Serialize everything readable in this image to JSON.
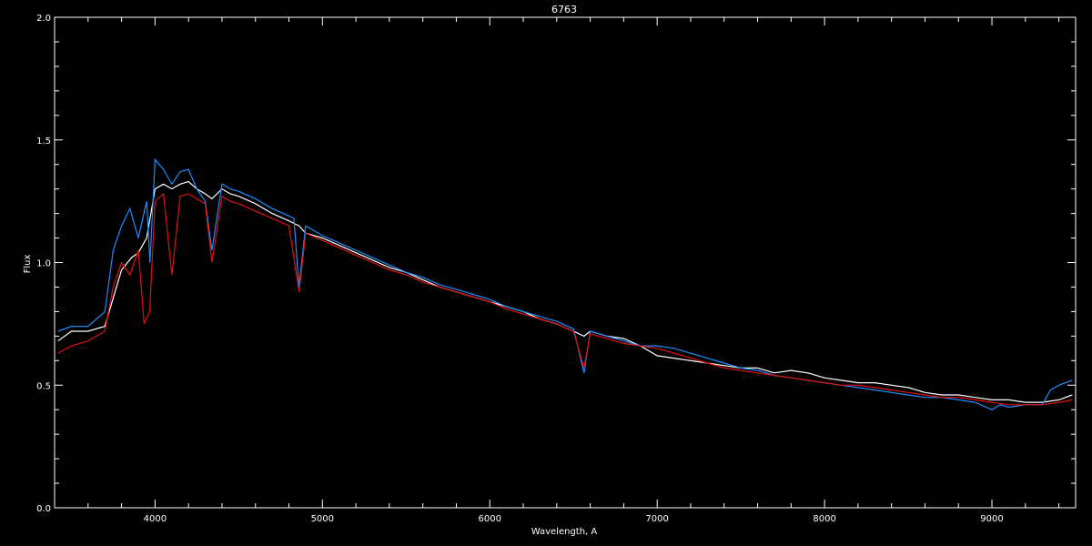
{
  "chart_data": {
    "type": "line",
    "title": "6763",
    "xlabel": "Wavelength, A",
    "ylabel": "Flux",
    "xlim": [
      3400,
      9500
    ],
    "ylim": [
      0,
      2
    ],
    "x_ticks": [
      4000,
      5000,
      6000,
      7000,
      8000,
      9000
    ],
    "x_tick_labels": [
      "4000",
      "5000",
      "6000",
      "7000",
      "8000",
      "9000"
    ],
    "y_ticks": [
      0,
      0.5,
      1,
      1.5,
      2
    ],
    "y_tick_labels": [
      "0.0",
      "0.5",
      "1.0",
      "1.5",
      "2.0"
    ],
    "grid": false,
    "background": "#000000",
    "colors": {
      "axes": "#ffffff",
      "observed_white": "#ffffff",
      "observed_blue": "#1e8cff",
      "model": "#e01010"
    },
    "series": [
      {
        "color": "#ffffff",
        "x": [
          3420,
          3500,
          3600,
          3700,
          3800,
          3860,
          3900,
          3950,
          4000,
          4050,
          4100,
          4150,
          4200,
          4250,
          4300,
          4340,
          4400,
          4450,
          4500,
          4600,
          4700,
          4800,
          4860,
          4900,
          5000,
          5100,
          5200,
          5300,
          5400,
          5500,
          5600,
          5700,
          5800,
          5900,
          6000,
          6100,
          6200,
          6300,
          6400,
          6500,
          6563,
          6600,
          6700,
          6800,
          6900,
          7000,
          7100,
          7200,
          7300,
          7400,
          7500,
          7600,
          7700,
          7800,
          7900,
          8000,
          8100,
          8200,
          8300,
          8400,
          8500,
          8600,
          8700,
          8800,
          8900,
          9000,
          9100,
          9200,
          9300,
          9400,
          9480
        ],
        "y": [
          0.68,
          0.72,
          0.72,
          0.74,
          0.97,
          1.02,
          1.04,
          1.1,
          1.3,
          1.32,
          1.3,
          1.32,
          1.33,
          1.3,
          1.28,
          1.26,
          1.3,
          1.28,
          1.27,
          1.24,
          1.2,
          1.17,
          1.15,
          1.12,
          1.1,
          1.07,
          1.04,
          1.01,
          0.98,
          0.96,
          0.93,
          0.9,
          0.88,
          0.86,
          0.84,
          0.82,
          0.8,
          0.77,
          0.75,
          0.72,
          0.7,
          0.72,
          0.7,
          0.69,
          0.66,
          0.62,
          0.61,
          0.6,
          0.59,
          0.58,
          0.57,
          0.57,
          0.55,
          0.56,
          0.55,
          0.53,
          0.52,
          0.51,
          0.51,
          0.5,
          0.49,
          0.47,
          0.46,
          0.46,
          0.45,
          0.44,
          0.44,
          0.43,
          0.43,
          0.44,
          0.46
        ]
      },
      {
        "color": "#1e8cff",
        "x": [
          3420,
          3500,
          3600,
          3700,
          3750,
          3800,
          3850,
          3900,
          3950,
          3970,
          4000,
          4050,
          4100,
          4150,
          4200,
          4250,
          4300,
          4340,
          4400,
          4450,
          4500,
          4600,
          4700,
          4800,
          4830,
          4860,
          4900,
          5000,
          5100,
          5200,
          5300,
          5400,
          5500,
          5600,
          5700,
          5800,
          5900,
          6000,
          6100,
          6200,
          6300,
          6400,
          6500,
          6563,
          6600,
          6700,
          6800,
          6900,
          7000,
          7100,
          7200,
          7300,
          7400,
          7500,
          7600,
          7700,
          7800,
          7900,
          8000,
          8100,
          8200,
          8300,
          8400,
          8500,
          8600,
          8700,
          8800,
          8900,
          9000,
          9050,
          9100,
          9200,
          9300,
          9350,
          9400,
          9480
        ],
        "y": [
          0.72,
          0.74,
          0.74,
          0.8,
          1.05,
          1.15,
          1.22,
          1.1,
          1.25,
          1.0,
          1.42,
          1.38,
          1.32,
          1.37,
          1.38,
          1.3,
          1.25,
          1.05,
          1.32,
          1.3,
          1.29,
          1.26,
          1.22,
          1.19,
          1.18,
          0.9,
          1.15,
          1.11,
          1.08,
          1.05,
          1.02,
          0.99,
          0.96,
          0.94,
          0.91,
          0.89,
          0.87,
          0.85,
          0.82,
          0.8,
          0.78,
          0.76,
          0.73,
          0.55,
          0.72,
          0.7,
          0.68,
          0.66,
          0.66,
          0.65,
          0.63,
          0.61,
          0.59,
          0.57,
          0.56,
          0.54,
          0.53,
          0.52,
          0.51,
          0.5,
          0.49,
          0.48,
          0.47,
          0.46,
          0.45,
          0.45,
          0.44,
          0.43,
          0.4,
          0.42,
          0.41,
          0.42,
          0.42,
          0.48,
          0.5,
          0.52
        ]
      },
      {
        "color": "#e01010",
        "x": [
          3420,
          3500,
          3600,
          3700,
          3750,
          3800,
          3850,
          3900,
          3935,
          3968,
          4000,
          4050,
          4101,
          4150,
          4200,
          4250,
          4300,
          4340,
          4400,
          4450,
          4500,
          4600,
          4700,
          4800,
          4861,
          4900,
          5000,
          5100,
          5200,
          5300,
          5400,
          5500,
          5600,
          5700,
          5800,
          5900,
          6000,
          6100,
          6200,
          6300,
          6400,
          6500,
          6563,
          6600,
          6700,
          6800,
          6900,
          7000,
          7100,
          7200,
          7300,
          7400,
          7500,
          7600,
          7700,
          7800,
          7900,
          8000,
          8100,
          8200,
          8300,
          8400,
          8500,
          8600,
          8700,
          8800,
          8900,
          9000,
          9100,
          9200,
          9300,
          9400,
          9480
        ],
        "y": [
          0.63,
          0.66,
          0.68,
          0.72,
          0.9,
          1.0,
          0.95,
          1.05,
          0.75,
          0.8,
          1.25,
          1.28,
          0.95,
          1.27,
          1.28,
          1.26,
          1.24,
          1.0,
          1.27,
          1.25,
          1.24,
          1.21,
          1.18,
          1.15,
          0.88,
          1.12,
          1.09,
          1.06,
          1.03,
          1.0,
          0.97,
          0.95,
          0.92,
          0.9,
          0.88,
          0.86,
          0.84,
          0.81,
          0.79,
          0.77,
          0.75,
          0.72,
          0.57,
          0.71,
          0.69,
          0.67,
          0.66,
          0.65,
          0.63,
          0.61,
          0.59,
          0.57,
          0.56,
          0.55,
          0.54,
          0.53,
          0.52,
          0.51,
          0.5,
          0.5,
          0.49,
          0.48,
          0.47,
          0.46,
          0.45,
          0.45,
          0.44,
          0.43,
          0.42,
          0.42,
          0.42,
          0.43,
          0.44
        ]
      }
    ]
  }
}
